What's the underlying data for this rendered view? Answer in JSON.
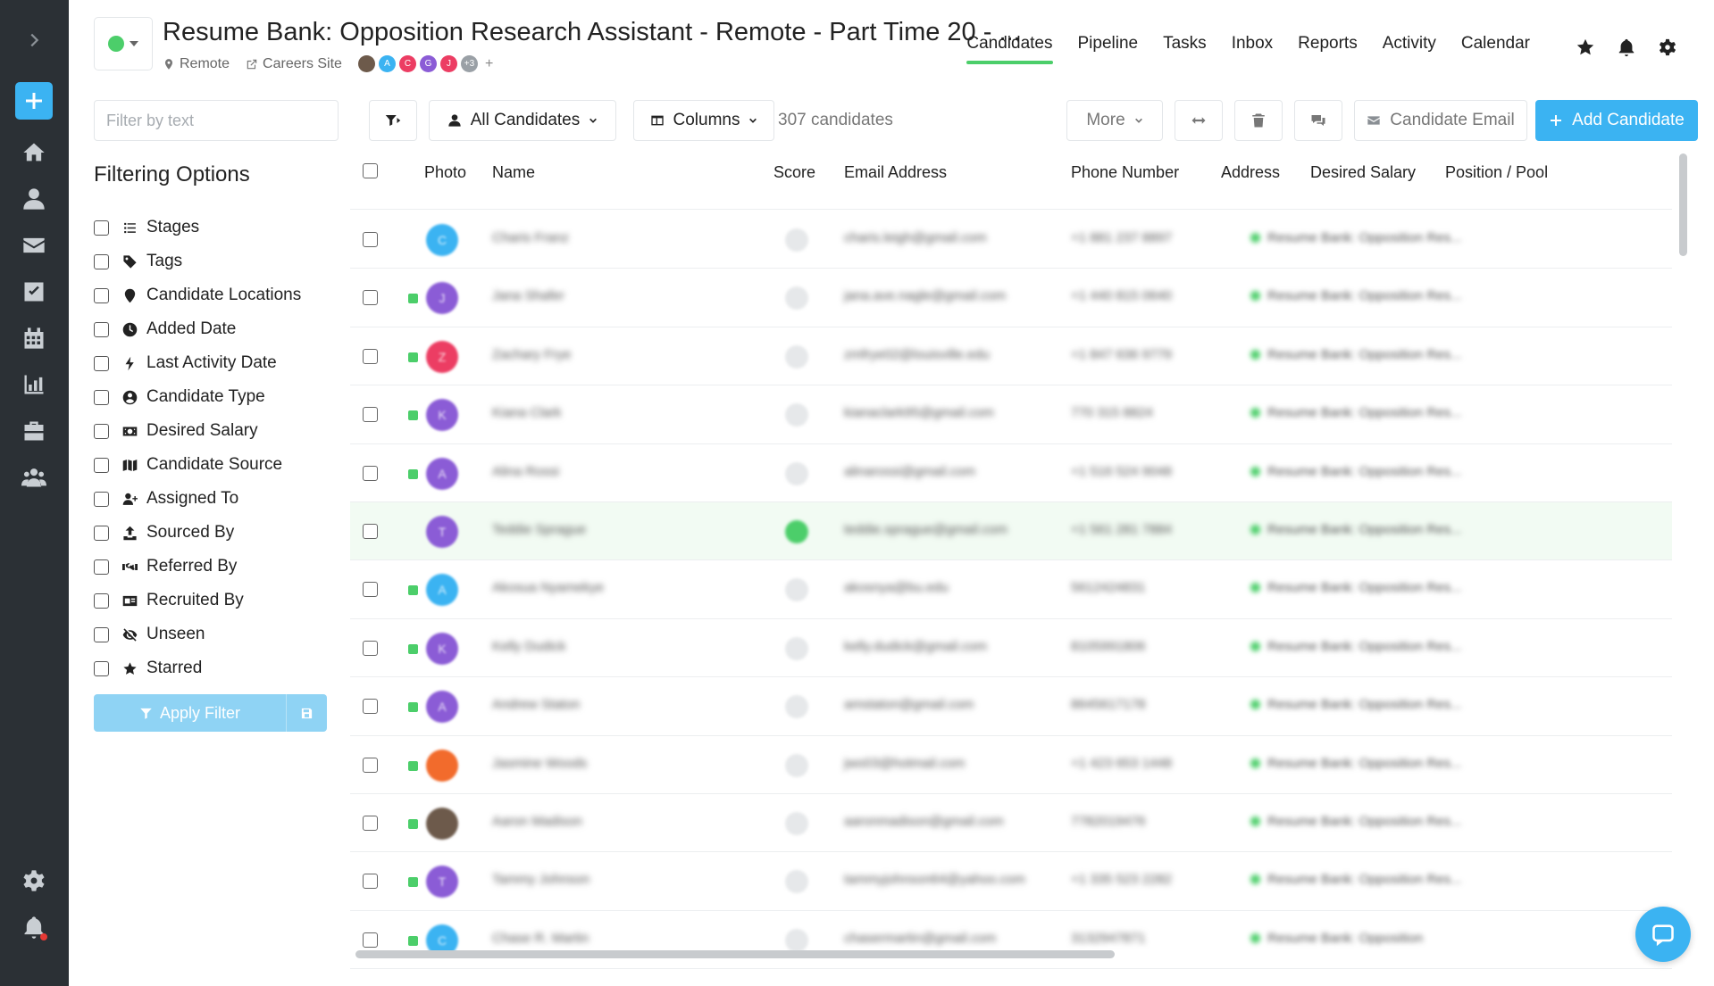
{
  "job": {
    "title": "Resume Bank: Opposition Research Assistant - Remote - Part Time 20 - ...",
    "location": "Remote",
    "careers_link": "Careers Site",
    "team": [
      {
        "initial": "",
        "color": "#6d5a4b"
      },
      {
        "initial": "A",
        "color": "#3bb3f2"
      },
      {
        "initial": "C",
        "color": "#ec3d63"
      },
      {
        "initial": "G",
        "color": "#8b5cd6"
      },
      {
        "initial": "J",
        "color": "#ec3d63"
      },
      {
        "initial": "+3",
        "color": "#9aa0a6"
      }
    ],
    "team_add": "+"
  },
  "nav": {
    "tabs": [
      "Candidates",
      "Pipeline",
      "Tasks",
      "Inbox",
      "Reports",
      "Activity",
      "Calendar"
    ],
    "active": "Candidates"
  },
  "filters": {
    "search_placeholder": "Filter by text",
    "title": "Filtering Options",
    "items": [
      {
        "label": "Stages",
        "icon": "list-icon"
      },
      {
        "label": "Tags",
        "icon": "tag-icon"
      },
      {
        "label": "Candidate Locations",
        "icon": "map-pin-icon"
      },
      {
        "label": "Added Date",
        "icon": "clock-icon"
      },
      {
        "label": "Last Activity Date",
        "icon": "bolt-icon"
      },
      {
        "label": "Candidate Type",
        "icon": "user-circle-icon"
      },
      {
        "label": "Desired Salary",
        "icon": "money-icon"
      },
      {
        "label": "Candidate Source",
        "icon": "map-icon"
      },
      {
        "label": "Assigned To",
        "icon": "user-plus-icon"
      },
      {
        "label": "Sourced By",
        "icon": "upload-icon"
      },
      {
        "label": "Referred By",
        "icon": "handshake-icon"
      },
      {
        "label": "Recruited By",
        "icon": "id-card-icon"
      },
      {
        "label": "Unseen",
        "icon": "eye-slash-icon"
      },
      {
        "label": "Starred",
        "icon": "star-icon"
      }
    ],
    "apply_label": "Apply Filter"
  },
  "toolbar": {
    "view_label": "All Candidates",
    "columns_label": "Columns",
    "count": "307 candidates",
    "more_label": "More",
    "email_label": "Candidate Email",
    "add_label": "Add Candidate"
  },
  "table": {
    "columns": [
      "Photo",
      "Name",
      "Score",
      "Email Address",
      "Phone Number",
      "Address",
      "Desired Salary",
      "Position / Pool"
    ],
    "rows": [
      {
        "avatar_color": "#3bb3f2",
        "initial": "C",
        "new": false,
        "name": "Charis Franz",
        "email": "charis.leigh@gmail.com",
        "phone": "+1 881 237 8897",
        "position": "Resume Bank: Opposition Res...",
        "score_green": false,
        "highlight": false
      },
      {
        "avatar_color": "#8b5cd6",
        "initial": "J",
        "new": true,
        "name": "Jana Shafer",
        "email": "jana.ave.nagle@gmail.com",
        "phone": "+1 440 815 0640",
        "position": "Resume Bank: Opposition Res...",
        "score_green": false,
        "highlight": false
      },
      {
        "avatar_color": "#ec3d63",
        "initial": "Z",
        "new": true,
        "name": "Zachary Frye",
        "email": "zmfrye02@louisville.edu",
        "phone": "+1 847 636 9779",
        "position": "Resume Bank: Opposition Res...",
        "score_green": false,
        "highlight": false
      },
      {
        "avatar_color": "#8b5cd6",
        "initial": "K",
        "new": true,
        "name": "Kiana Clark",
        "email": "kianaclark95@gmail.com",
        "phone": "770 315 8824",
        "position": "Resume Bank: Opposition Res...",
        "score_green": false,
        "highlight": false
      },
      {
        "avatar_color": "#8b5cd6",
        "initial": "A",
        "new": true,
        "name": "Alina Rossi",
        "email": "alinarossi@gmail.com",
        "phone": "+1 516 524 9048",
        "position": "Resume Bank: Opposition Res...",
        "score_green": false,
        "highlight": false
      },
      {
        "avatar_color": "#8b5cd6",
        "initial": "T",
        "new": false,
        "name": "Teddie Sprague",
        "email": "teddie.sprague@gmail.com",
        "phone": "+1 561 281 7884",
        "position": "Resume Bank: Opposition Res...",
        "score_green": true,
        "highlight": true
      },
      {
        "avatar_color": "#3bb3f2",
        "initial": "A",
        "new": true,
        "name": "Akosua Nyamekye",
        "email": "akosnya@bu.edu",
        "phone": "5612424831",
        "position": "Resume Bank: Opposition Res...",
        "score_green": false,
        "highlight": false
      },
      {
        "avatar_color": "#8b5cd6",
        "initial": "K",
        "new": true,
        "name": "Kelly Dudick",
        "email": "kelly.dudick@gmail.com",
        "phone": "8105991806",
        "position": "Resume Bank: Opposition Res...",
        "score_green": false,
        "highlight": false
      },
      {
        "avatar_color": "#8b5cd6",
        "initial": "A",
        "new": true,
        "name": "Andrew Staton",
        "email": "amstaton@gmail.com",
        "phone": "8645617178",
        "position": "Resume Bank: Opposition Res...",
        "score_green": false,
        "highlight": false
      },
      {
        "avatar_color": "#f26b2c",
        "initial": "",
        "new": true,
        "name": "Jasmine Woods",
        "email": "jwo03@hotmail.com",
        "phone": "+1 423 653 1448",
        "position": "Resume Bank: Opposition Res...",
        "score_green": false,
        "highlight": false
      },
      {
        "avatar_color": "#6d5a4b",
        "initial": "",
        "new": true,
        "name": "Aaron Madison",
        "email": "aaronmadison@gmail.com",
        "phone": "7782019476",
        "position": "Resume Bank: Opposition Res...",
        "score_green": false,
        "highlight": false
      },
      {
        "avatar_color": "#8b5cd6",
        "initial": "T",
        "new": true,
        "name": "Tammy Johnson",
        "email": "tammyjohnson64@yahoo.com",
        "phone": "+1 335 523 2282",
        "position": "Resume Bank: Opposition Res...",
        "score_green": false,
        "highlight": false
      },
      {
        "avatar_color": "#3bb3f2",
        "initial": "C",
        "new": true,
        "name": "Chase R. Martin",
        "email": "chasermartin@gmail.com",
        "phone": "3132947871",
        "position": "Resume Bank: Opposition",
        "score_green": false,
        "highlight": false
      }
    ]
  },
  "colors": {
    "accent": "#3bb3f2",
    "success": "#4cce6a",
    "rail": "#2b3035"
  }
}
